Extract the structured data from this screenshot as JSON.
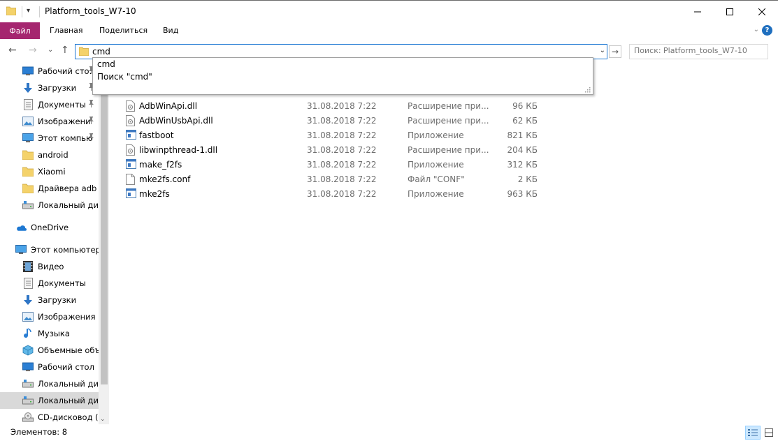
{
  "window": {
    "title": "Platform_tools_W7-10",
    "quick_access_symbol": "▾"
  },
  "ribbon": {
    "file_tab": "Файл",
    "tabs": [
      "Главная",
      "Поделиться",
      "Вид"
    ],
    "collapse_symbol": "⌄",
    "help_symbol": "?"
  },
  "nav": {
    "back_symbol": "←",
    "forward_symbol": "→",
    "recent_symbol": "⌄",
    "up_symbol": "↑",
    "address_value": "cmd",
    "dropdown_symbol": "⌄",
    "go_symbol": "→",
    "search_placeholder": "Поиск: Platform_tools_W7-10"
  },
  "suggestions": [
    "cmd",
    "Поиск \"cmd\""
  ],
  "sidebar": {
    "items": [
      {
        "label": "Рабочий сто.",
        "icon": "desktop-icon",
        "pinned": true
      },
      {
        "label": "Загрузки",
        "icon": "downloads-icon",
        "pinned": true
      },
      {
        "label": "Документы",
        "icon": "documents-icon",
        "pinned": true
      },
      {
        "label": "Изображени",
        "icon": "pictures-icon",
        "pinned": true
      },
      {
        "label": "Этот компью",
        "icon": "this-pc-icon",
        "pinned": true
      },
      {
        "label": "android",
        "icon": "folder-icon",
        "pinned": false
      },
      {
        "label": "Xiaomi",
        "icon": "folder-icon",
        "pinned": false
      },
      {
        "label": "Драйвера adb",
        "icon": "folder-icon",
        "pinned": false
      },
      {
        "label": "Локальный дис",
        "icon": "drive-icon",
        "pinned": false
      },
      {
        "label": "OneDrive",
        "icon": "onedrive-icon",
        "pinned": false
      },
      {
        "label": "Этот компьютер",
        "icon": "this-pc-icon",
        "pinned": false
      },
      {
        "label": "Видео",
        "icon": "videos-icon",
        "pinned": false
      },
      {
        "label": "Документы",
        "icon": "documents-icon",
        "pinned": false
      },
      {
        "label": "Загрузки",
        "icon": "downloads-icon",
        "pinned": false
      },
      {
        "label": "Изображения",
        "icon": "pictures-icon",
        "pinned": false
      },
      {
        "label": "Музыка",
        "icon": "music-icon",
        "pinned": false
      },
      {
        "label": "Объемные объ",
        "icon": "3d-objects-icon",
        "pinned": false
      },
      {
        "label": "Рабочий стол",
        "icon": "desktop-icon",
        "pinned": false
      },
      {
        "label": "Локальный дис",
        "icon": "drive-icon",
        "pinned": false
      },
      {
        "label": "Локальный дис",
        "icon": "drive-icon",
        "pinned": false,
        "selected": true
      },
      {
        "label": "CD-дисковод (G",
        "icon": "cd-drive-icon",
        "pinned": false
      }
    ],
    "pin_symbol": "📌",
    "scroll_down_symbol": "⌄"
  },
  "files": [
    {
      "name": "AdbWinApi.dll",
      "date": "31.08.2018 7:22",
      "type": "Расширение при...",
      "size": "96 КБ",
      "icon": "dll-icon"
    },
    {
      "name": "AdbWinUsbApi.dll",
      "date": "31.08.2018 7:22",
      "type": "Расширение при...",
      "size": "62 КБ",
      "icon": "dll-icon"
    },
    {
      "name": "fastboot",
      "date": "31.08.2018 7:22",
      "type": "Приложение",
      "size": "821 КБ",
      "icon": "exe-icon"
    },
    {
      "name": "libwinpthread-1.dll",
      "date": "31.08.2018 7:22",
      "type": "Расширение при...",
      "size": "204 КБ",
      "icon": "dll-icon"
    },
    {
      "name": "make_f2fs",
      "date": "31.08.2018 7:22",
      "type": "Приложение",
      "size": "312 КБ",
      "icon": "exe-icon"
    },
    {
      "name": "mke2fs.conf",
      "date": "31.08.2018 7:22",
      "type": "Файл \"CONF\"",
      "size": "2 КБ",
      "icon": "file-icon"
    },
    {
      "name": "mke2fs",
      "date": "31.08.2018 7:22",
      "type": "Приложение",
      "size": "963 КБ",
      "icon": "exe-icon"
    }
  ],
  "status": {
    "items_count": "Элементов: 8"
  },
  "colors": {
    "file_tab": "#a5266f",
    "address_border": "#1f79d3",
    "selected_item": "#d9d9d9"
  }
}
